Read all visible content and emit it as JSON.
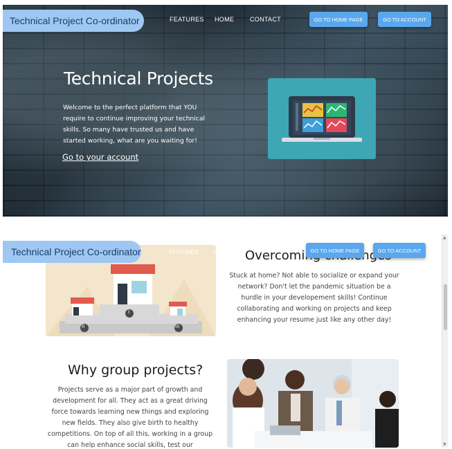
{
  "top_view": {
    "brand": "Technical Project Co-ordinator",
    "nav": [
      "FEATURES",
      "HOME",
      "CONTACT"
    ],
    "buttons": {
      "home": "GO TO HOME PAGE",
      "account": "GO TO ACCOUNT"
    },
    "hero": {
      "title": "Technical Projects",
      "text": "Welcome to the perfect platform that YOU require to continue improving your technical skills. So many have trusted us and have started working, what are you waiting for!",
      "link": "Go to your account"
    }
  },
  "bottom_view": {
    "brand": "Technical Project Co-ordinator",
    "nav": [
      "FEATURES",
      "H"
    ],
    "buttons": {
      "home": "GO TO HOME PAGE",
      "account": "GO TO ACCOUNT"
    },
    "overcoming": {
      "title": "Overcoming challenges",
      "text": "Stuck at home? Not able to socialize or expand your network? Don't let the pandemic situation be a hurdle in your developement skills! Continue collaborating and working on projects and keep enhancing your resume just like any other day!"
    },
    "group": {
      "title": "Why group projects?",
      "text": "Projects serve as a major part of growth and development for all. They act as a great driving force towards learning new things and exploring new fields. They also give birth to healthy competitions. On top of all this, working in a group can help enhance social skills, test our"
    },
    "podium_labels": [
      "I",
      "II",
      "III"
    ]
  },
  "colors": {
    "accent_blue": "#5aa7ee",
    "brand_pill": "#9ec8f2",
    "laptop_card": "#3ea6b4"
  }
}
